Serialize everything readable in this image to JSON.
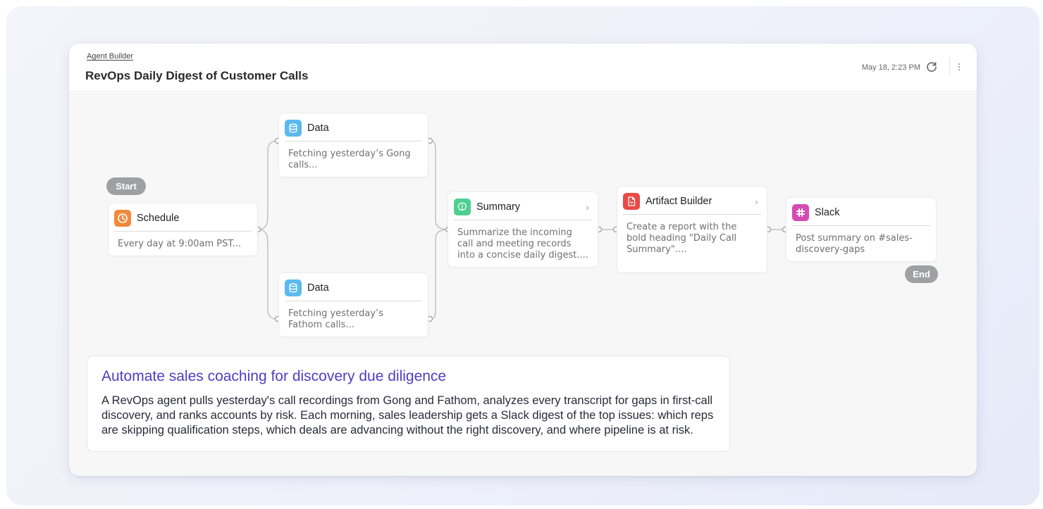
{
  "header": {
    "breadcrumb": "Agent Builder",
    "title": "RevOps Daily Digest of Customer Calls",
    "timestamp": "May 18, 2:23 PM",
    "refresh_icon": "refresh-icon",
    "more_icon": "more-vertical-icon"
  },
  "flow": {
    "start_label": "Start",
    "end_label": "End",
    "nodes": [
      {
        "title": "Schedule",
        "description": "Every day at 9:00am PST...",
        "icon": "clock-icon",
        "color": "#f08a3a"
      },
      {
        "title": "Data",
        "description": "Fetching yesterday’s Gong calls...",
        "icon": "database-icon",
        "color": "#5cb9ee"
      },
      {
        "title": "Data",
        "description": "Fetching yesterday’s Fathom calls...",
        "icon": "database-icon",
        "color": "#5cb9ee"
      },
      {
        "title": "Summary",
        "description": "Summarize the incoming call and meeting records into a concise daily digest....",
        "icon": "brain-icon",
        "color": "#4fcf8f"
      },
      {
        "title": "Artifact Builder",
        "description": "Create a report with the bold heading \"Daily Call Summary\"....",
        "icon": "document-icon",
        "color": "#ea4a45"
      },
      {
        "title": "Slack",
        "description": "Post summary on #sales-discovery-gaps",
        "icon": "slack-icon",
        "color": "#d54bb3"
      }
    ]
  },
  "info": {
    "title": "Automate sales coaching for discovery due diligence",
    "body": "A RevOps agent pulls yesterday's call recordings from Gong and Fathom, analyzes every transcript for gaps in first-call discovery, and ranks accounts by risk. Each morning, sales leadership gets a Slack digest of the top issues: which reps are skipping qualification steps, which deals are advancing without the right discovery, and where pipeline is at risk."
  }
}
